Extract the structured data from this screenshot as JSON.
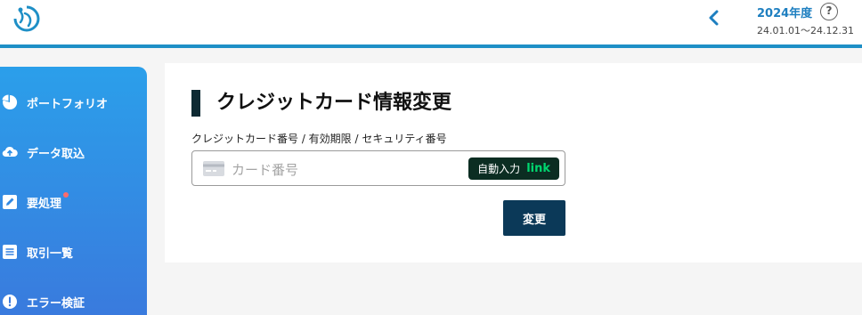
{
  "header": {
    "fiscal_year": "2024年度",
    "help_symbol": "?",
    "fiscal_range": "24.01.01〜24.12.31"
  },
  "sidebar": {
    "items": [
      {
        "label": "ポートフォリオ",
        "icon": "pie-chart-icon"
      },
      {
        "label": "データ取込",
        "icon": "cloud-upload-icon"
      },
      {
        "label": "要処理",
        "icon": "edit-icon",
        "badge": true
      },
      {
        "label": "取引一覧",
        "icon": "list-icon"
      },
      {
        "label": "エラー検証",
        "icon": "alert-icon"
      }
    ]
  },
  "main": {
    "title": "クレジットカード情報変更",
    "field_label": "クレジットカード番号 / 有効期限 / セキュリティ番号",
    "card_placeholder": "カード番号",
    "autofill_label": "自動入力",
    "autofill_brand": "link",
    "submit_label": "変更"
  },
  "colors": {
    "accent": "#1e8fc6",
    "sidebar_top": "#2b9fea",
    "sidebar_bottom": "#3a79dd",
    "button": "#0b3958",
    "link_green": "#00d66f",
    "badge": "#ff6b6b"
  }
}
